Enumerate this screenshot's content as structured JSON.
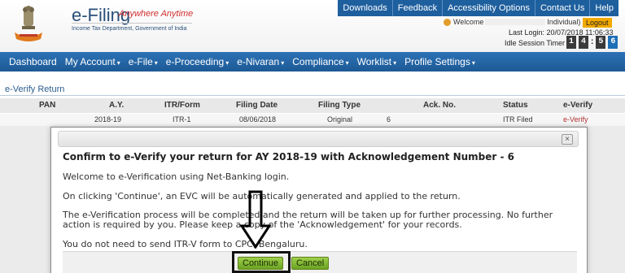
{
  "header": {
    "brand": "e-Filing",
    "tagline": "Anywhere Anytime",
    "department": "Income Tax Department, Government of India",
    "topnav": [
      "Downloads",
      "Feedback",
      "Accessibility Options",
      "Contact Us",
      "Help"
    ],
    "welcome_prefix": "Welcome",
    "welcome_suffix": "Individual)",
    "logout": "Logout",
    "last_login": "Last Login: 20/07/2018 11:06:33",
    "idle_timer_label": "Idle Session Timer",
    "timer_digits": [
      "1",
      "4",
      ":",
      "5",
      "6"
    ]
  },
  "mainnav": {
    "items": [
      "Dashboard",
      "My Account",
      "e-File",
      "e-Proceeding",
      "e-Nivaran",
      "Compliance",
      "Worklist",
      "Profile Settings"
    ]
  },
  "section": {
    "title": "e-Verify Return"
  },
  "table": {
    "headers": [
      "PAN",
      "A.Y.",
      "ITR/Form",
      "Filing Date",
      "Filing Type",
      "Ack. No.",
      "Status",
      "e-Verify"
    ],
    "row": {
      "pan": "",
      "ay": "2018-19",
      "itr": "ITR-1",
      "filing_date": "08/06/2018",
      "filing_type": "Original",
      "ack_no": "6",
      "status": "ITR Filed",
      "everify": "e-Verify"
    }
  },
  "modal": {
    "close": "×",
    "title": "Confirm to e-Verify your return for AY 2018-19 with Acknowledgement Number - 6",
    "para1": "Welcome to e-Verification using Net-Banking login.",
    "para2": "On clicking 'Continue', an EVC will be automatically generated and applied to the return.",
    "para3a": "The e-Verification process will be completed and the return will be taken up for further processing. No further",
    "para3b": "action is required by you. Please keep a copy of the 'Acknowledgement' for your records.",
    "para4": "You do not need to send ITR-V form to CPC, Bengaluru.",
    "continue": "Continue",
    "cancel": "Cancel"
  },
  "colors": {
    "nav_blue": "#1d5a95",
    "logout_orange": "#f2a900",
    "button_green": "#7fb82f",
    "link_red": "#b03030"
  },
  "icons": [
    "emblem-logo-icon",
    "user-icon",
    "close-icon",
    "down-arrow-annotation-icon"
  ]
}
